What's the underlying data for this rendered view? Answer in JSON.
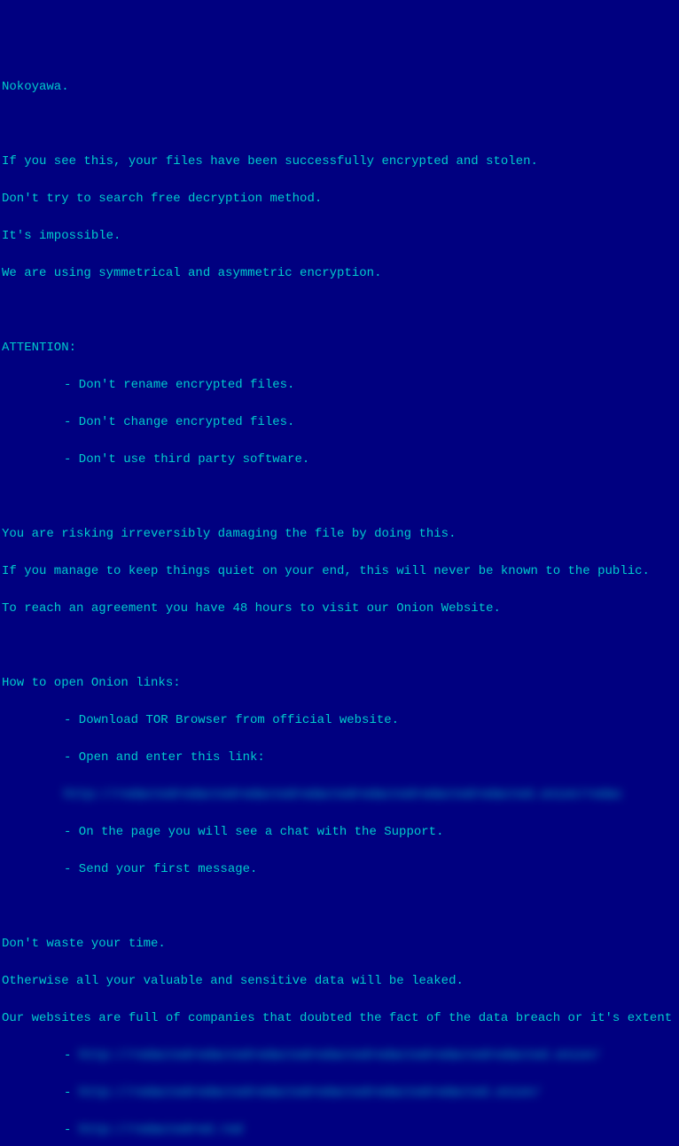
{
  "title": "Nokoyawa.",
  "intro": [
    "If you see this, your files have been successfully encrypted and stolen.",
    "Don't try to search free decryption method.",
    "It's impossible.",
    "We are using symmetrical and asymmetric encryption."
  ],
  "attention_header": "ATTENTION:",
  "attention_items": [
    "- Don't rename encrypted files.",
    "- Don't change encrypted files.",
    "- Don't use third party software."
  ],
  "warning": [
    "You are risking irreversibly damaging the file by doing this.",
    "If you manage to keep things quiet on your end, this will never be known to the public.",
    "To reach an agreement you have 48 hours to visit our Onion Website."
  ],
  "howto_header": "How to open Onion links:",
  "howto_items": [
    "- Download TOR Browser from official website.",
    "- Open and enter this link:"
  ],
  "redacted_link": "http://redactedredactedredactedredactedredactedredactedredacted.onion/redac",
  "howto_items_after": [
    "- On the page you will see a chat with the Support.",
    "- Send your first message."
  ],
  "closing": [
    "Don't waste your time.",
    "Otherwise all your valuable and sensitive data will be leaked.",
    "Our websites are full of companies that doubted the fact of the data breach or it's extent"
  ],
  "bullet_prefix": "- ",
  "redacted_sites": [
    "http://redactedredactedredactedredactedredactedredactedredacted.onion/",
    "http://redactedredactedredactedredactedredactedredacted.onion/",
    "http://redactedred.red"
  ]
}
